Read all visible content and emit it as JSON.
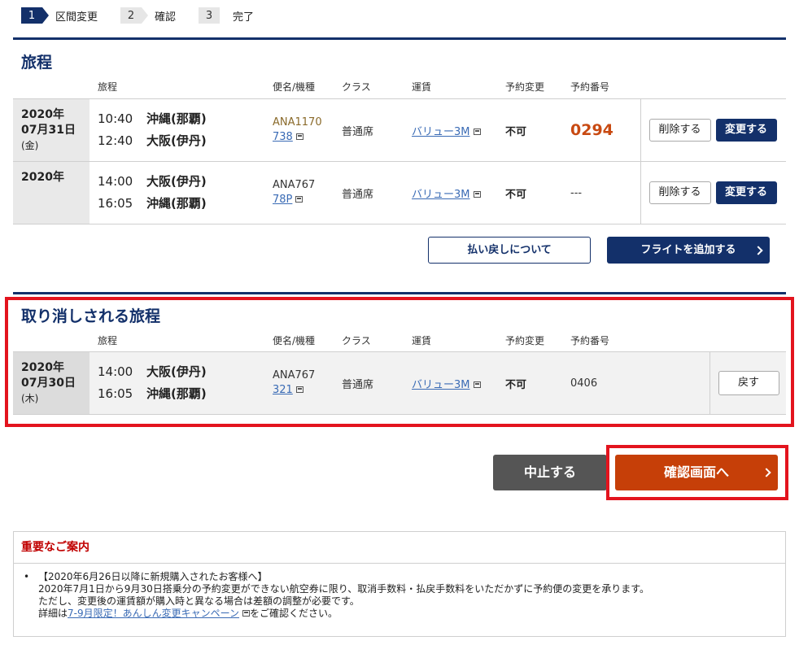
{
  "stepper": [
    {
      "num": "1",
      "label": "区間変更"
    },
    {
      "num": "2",
      "label": "確認"
    },
    {
      "num": "3",
      "label": "完了"
    }
  ],
  "itinerary": {
    "title": "旅程",
    "headers": {
      "route": "旅程",
      "flight": "便名/機種",
      "class": "クラス",
      "fare": "運賃",
      "change": "予約変更",
      "reservation": "予約番号"
    },
    "rows": [
      {
        "year": "2020年",
        "date": "07月31日",
        "dow": "(金)",
        "dep_time": "10:40",
        "dep_place": "沖縄(那覇)",
        "arr_time": "12:40",
        "arr_place": "大阪(伊丹)",
        "flight": "ANA1170",
        "aircraft": "738",
        "class": "普通席",
        "fare": "バリュー3M",
        "change": "不可",
        "reservation": "0294",
        "delete": "削除する",
        "modify": "変更する"
      },
      {
        "year": "2020年",
        "date": "",
        "dow": "",
        "dep_time": "14:00",
        "dep_place": "大阪(伊丹)",
        "arr_time": "16:05",
        "arr_place": "沖縄(那覇)",
        "flight": "ANA767",
        "aircraft": "78P",
        "class": "普通席",
        "fare": "バリュー3M",
        "change": "不可",
        "reservation": "---",
        "delete": "削除する",
        "modify": "変更する"
      }
    ],
    "refund_button": "払い戻しについて",
    "add_flight_button": "フライトを追加する"
  },
  "cancelled": {
    "title": "取り消しされる旅程",
    "headers": {
      "route": "旅程",
      "flight": "便名/機種",
      "class": "クラス",
      "fare": "運賃",
      "change": "予約変更",
      "reservation": "予約番号"
    },
    "row": {
      "year": "2020年",
      "date": "07月30日",
      "dow": "(木)",
      "dep_time": "14:00",
      "dep_place": "大阪(伊丹)",
      "arr_time": "16:05",
      "arr_place": "沖縄(那覇)",
      "flight": "ANA767",
      "aircraft": "321",
      "class": "普通席",
      "fare": "バリュー3M",
      "change": "不可",
      "reservation": "0406",
      "back": "戻す"
    }
  },
  "actions": {
    "cancel": "中止する",
    "confirm": "確認画面へ"
  },
  "notice": {
    "title": "重要なご案内",
    "line1": "【2020年6月26日以降に新規購入されたお客様へ】",
    "line2": "2020年7月1日から9月30日搭乗分の予約変更ができない航空券に限り、取消手数料・払戻手数料をいただかずに予約便の変更を承ります。",
    "line3": "ただし、変更後の運賃額が購入時と異なる場合は差額の調整が必要です。",
    "line4_prefix": "詳細は",
    "line4_link": "7-9月限定！あんしん変更キャンペーン",
    "line4_suffix": "をご確認ください。"
  },
  "colors": {
    "navy": "#13306a",
    "orange": "#c63f08",
    "red_highlight": "#e3141e",
    "notice_red": "#c00000"
  }
}
